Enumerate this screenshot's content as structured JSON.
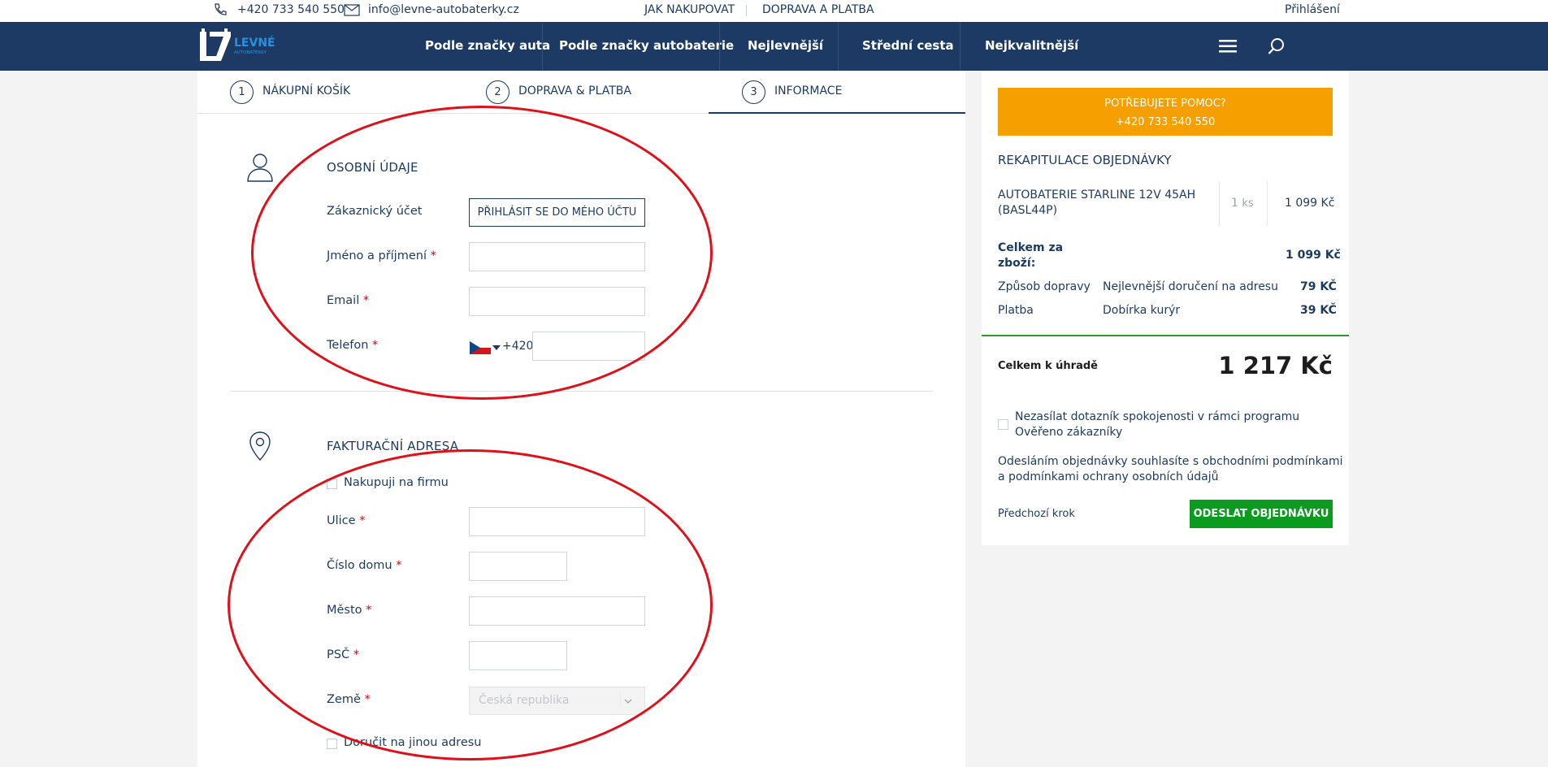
{
  "topbar": {
    "phone": "+420 733 540 550",
    "email": "info@levne-autobaterky.cz",
    "how_to_buy": "JAK NAKUPOVAT",
    "shipping_payment": "DOPRAVA A PLATBA",
    "login": "Přihlášení"
  },
  "nav": {
    "logo_text": "LEVNÉ",
    "logo_sub": "AUTOBATERKY",
    "items": [
      "Podle značky auta",
      "Podle značky autobaterie",
      "Nejlevnější",
      "Střední cesta",
      "Nejkvalitnější"
    ]
  },
  "steps": [
    {
      "num": "1",
      "label": "NÁKUPNÍ KOŠÍK"
    },
    {
      "num": "2",
      "label": "DOPRAVA & PLATBA"
    },
    {
      "num": "3",
      "label": "INFORMACE"
    }
  ],
  "personal": {
    "title": "OSOBNÍ ÚDAJE",
    "account_label": "Zákaznický účet",
    "login_button": "PŘIHLÁSIT SE DO MÉHO ÚČTU",
    "name_label": "Jméno a příjmení",
    "email_label": "Email",
    "phone_label": "Telefon",
    "phone_prefix": "+420",
    "required_mark": "*"
  },
  "billing": {
    "title": "FAKTURAČNÍ ADRESA",
    "company_checkbox": "Nakupuji na firmu",
    "street_label": "Ulice",
    "house_label": "Číslo domu",
    "city_label": "Město",
    "zip_label": "PSČ",
    "country_label": "Země",
    "country_value": "Česká republika",
    "other_address_checkbox": "Doručit na jinou adresu"
  },
  "summary": {
    "help_title": "POTŘEBUJETE POMOC?",
    "help_phone": "+420 733 540 550",
    "recap_title": "REKAPITULACE OBJEDNÁVKY",
    "product_name_line1": "AUTOBATERIE STARLINE 12V 45AH",
    "product_name_line2": "(BASL44P)",
    "product_qty": "1",
    "product_qty_unit": "ks",
    "product_price": "1 099 Kč",
    "goods_total_label_line1": "Celkem za",
    "goods_total_label_line2": "zboží:",
    "goods_total_value": "1 099 Kč",
    "shipping_label": "Způsob dopravy",
    "shipping_method": "Nejlevnější doručení na adresu",
    "shipping_price": "79 KČ",
    "payment_label": "Platba",
    "payment_method": "Dobírka kurýr",
    "payment_price": "39 KČ",
    "total_label": "Celkem k úhradě",
    "total_value": "1 217 Kč",
    "survey_checkbox_line1": "Nezasílat dotazník spokojenosti v rámci programu",
    "survey_checkbox_line2": "Ověřeno zákazníky",
    "terms_line1": "Odesláním objednávky souhlasíte s obchodními podmínkami",
    "terms_line2": "a podmínkami ochrany osobních údajů",
    "prev_step": "Předchozí krok",
    "submit": "ODESLAT OBJEDNÁVKU"
  },
  "colors": {
    "nav_bg": "#1c3a63",
    "accent_orange": "#f5a000",
    "submit_green": "#0a9b1f",
    "annotation_red": "#e0101a"
  }
}
